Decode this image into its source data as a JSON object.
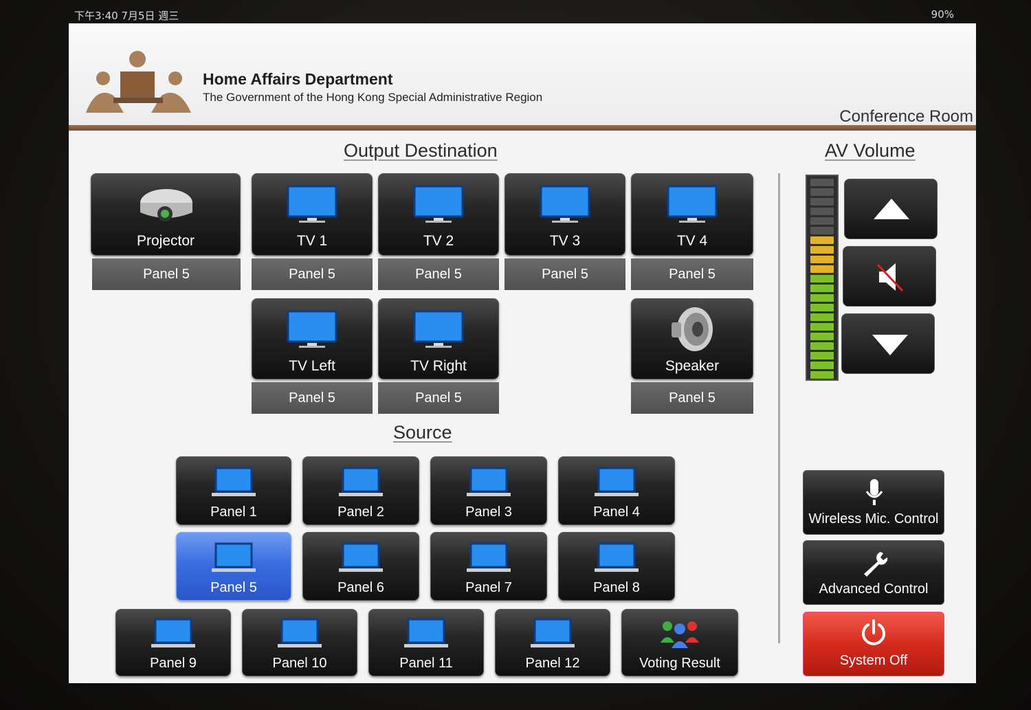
{
  "status_bar": {
    "time": "下午3:40 7月5日 週三",
    "battery": "90%"
  },
  "header": {
    "org_title": "Home Affairs Department",
    "org_subtitle": "The Government of the Hong Kong Special Administrative Region",
    "room": "Conference Room"
  },
  "output": {
    "title": "Output Destination",
    "destinations": [
      {
        "label": "Projector",
        "source": "Panel 5",
        "icon": "projector-icon"
      },
      {
        "label": "TV 1",
        "source": "Panel 5",
        "icon": "tv-icon"
      },
      {
        "label": "TV 2",
        "source": "Panel 5",
        "icon": "tv-icon"
      },
      {
        "label": "TV 3",
        "source": "Panel 5",
        "icon": "tv-icon"
      },
      {
        "label": "TV 4",
        "source": "Panel 5",
        "icon": "tv-icon"
      },
      {
        "label": "TV Left",
        "source": "Panel 5",
        "icon": "tv-icon"
      },
      {
        "label": "TV Right",
        "source": "Panel 5",
        "icon": "tv-icon"
      },
      {
        "label": "Speaker",
        "source": "Panel 5",
        "icon": "speaker-icon"
      }
    ]
  },
  "source": {
    "title": "Source",
    "selected": "Panel 5",
    "items": [
      "Panel 1",
      "Panel 2",
      "Panel 3",
      "Panel 4",
      "Panel 5",
      "Panel 6",
      "Panel 7",
      "Panel 8",
      "Panel 9",
      "Panel 10",
      "Panel 11",
      "Panel 12",
      "Voting Result"
    ]
  },
  "volume": {
    "title": "AV Volume",
    "level_segments_lit": 15,
    "level_segments_total": 21,
    "colors": {
      "green": "#7ec02a",
      "yellow": "#e2b22a",
      "off": "#555555"
    }
  },
  "side": {
    "wireless_mic": "Wireless Mic. Control",
    "advanced": "Advanced Control",
    "system_off": "System Off"
  },
  "colors": {
    "accent_blue": "#3b6ee0",
    "header_rule": "#8a6443",
    "power_red": "#d62b1e"
  }
}
